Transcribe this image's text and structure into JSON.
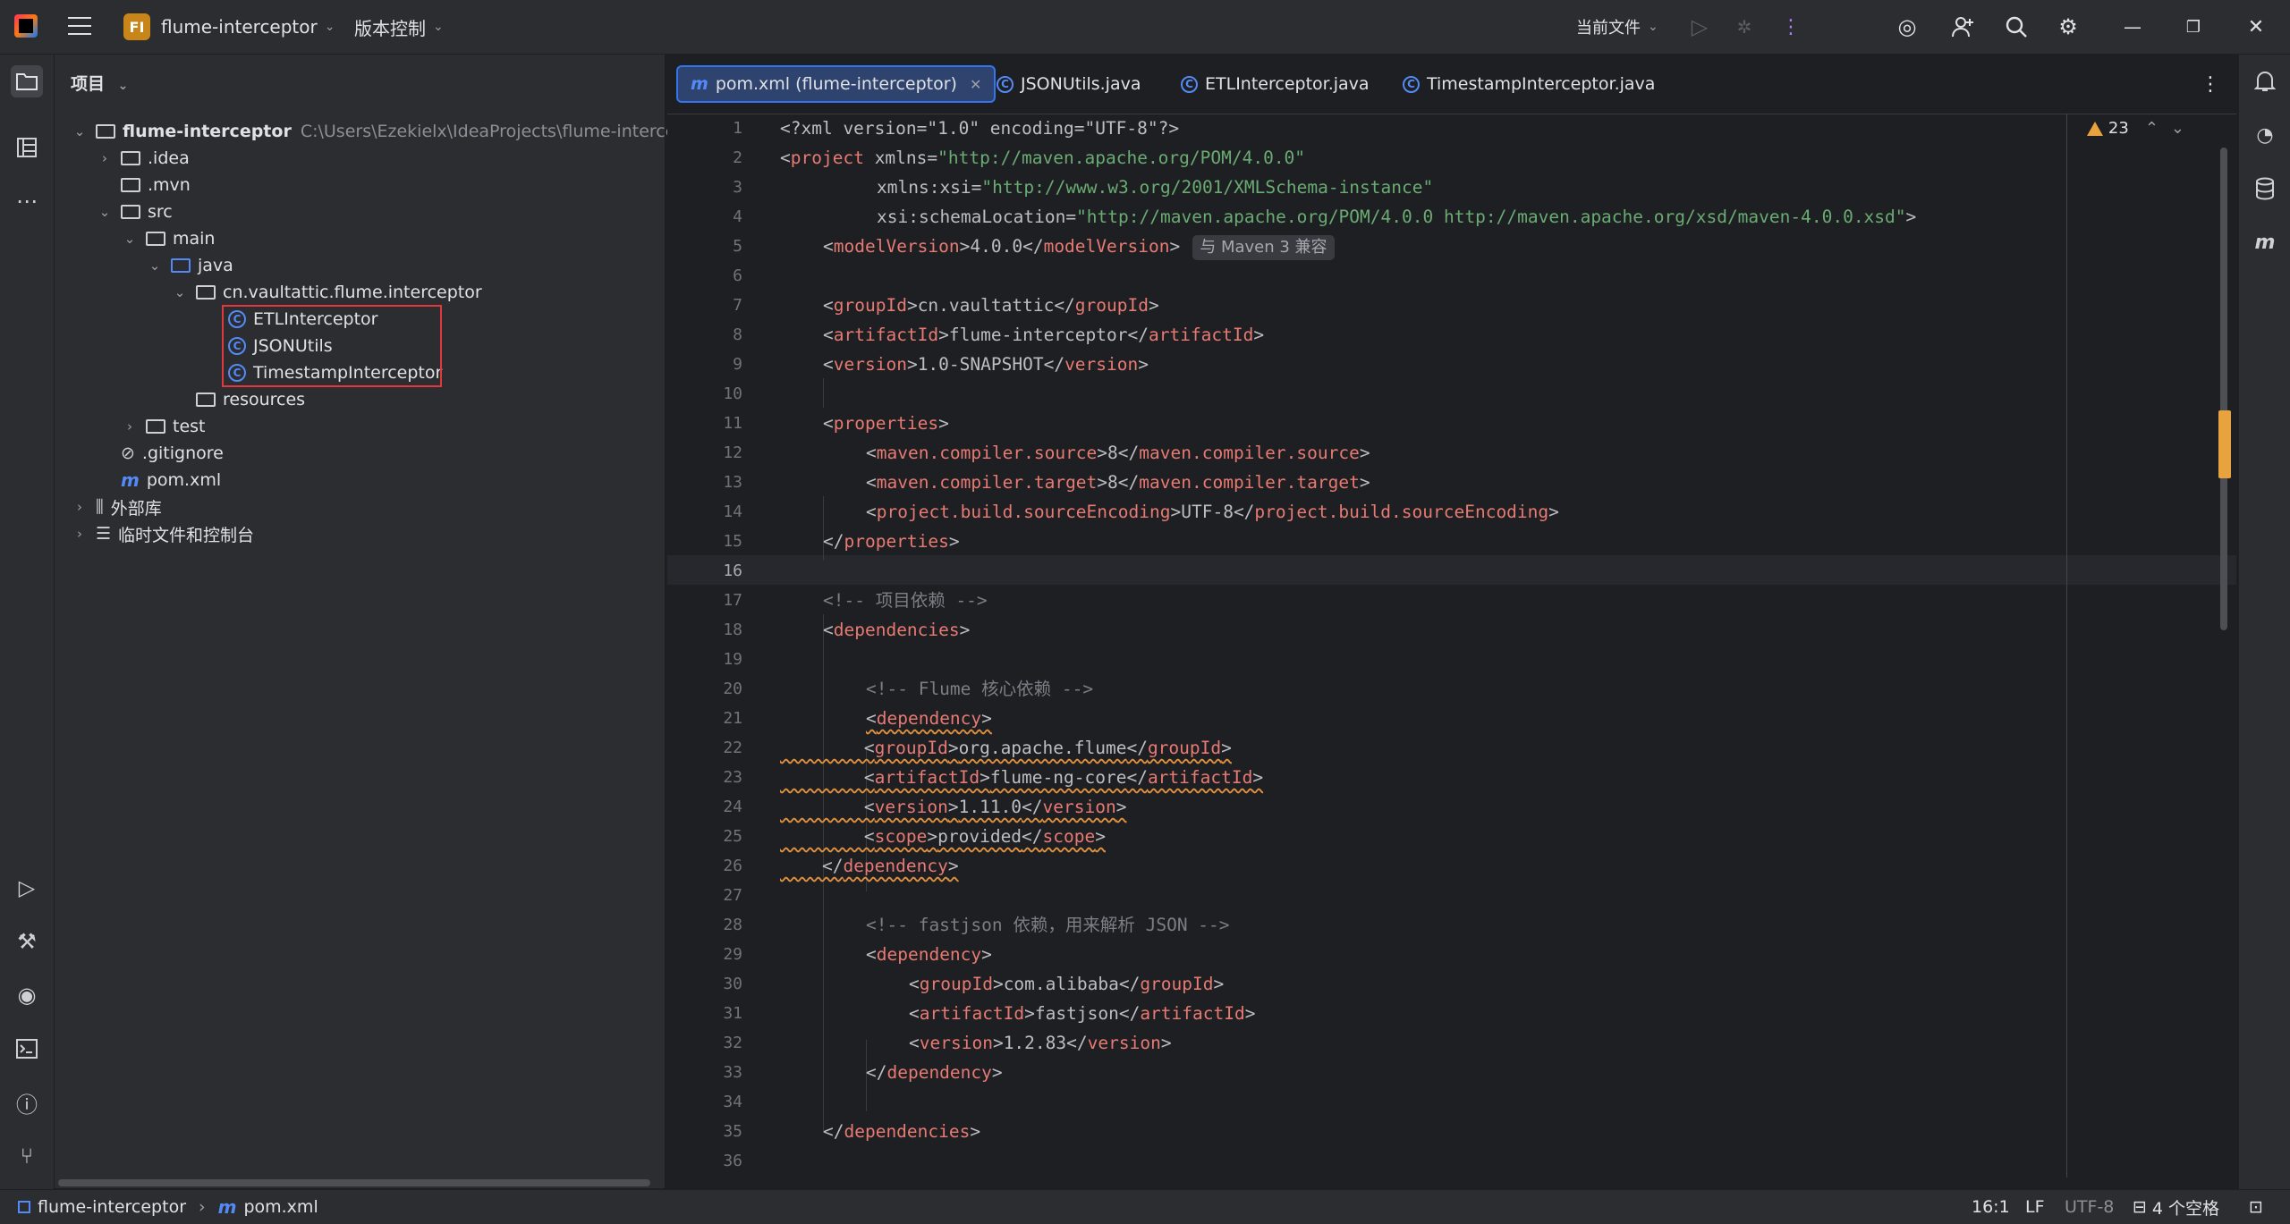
{
  "titlebar": {
    "project_badge": "FI",
    "project_name": "flume-interceptor",
    "vcs": "版本控制",
    "run_config": "当前文件"
  },
  "project_panel": {
    "title": "项目",
    "root_name": "flume-interceptor",
    "root_path": "C:\\Users\\Ezekielx\\IdeaProjects\\flume-interceptor",
    "idea": ".idea",
    "mvn": ".mvn",
    "src": "src",
    "main": "main",
    "java": "java",
    "package": "cn.vaultattic.flume.interceptor",
    "classes": [
      "ETLInterceptor",
      "JSONUtils",
      "TimestampInterceptor"
    ],
    "resources": "resources",
    "test": "test",
    "gitignore": ".gitignore",
    "pom": "pom.xml",
    "external_libs": "外部库",
    "scratches": "临时文件和控制台"
  },
  "tabs": [
    {
      "label": "pom.xml (flume-interceptor)",
      "icon": "maven-icon",
      "active": true
    },
    {
      "label": "JSONUtils.java",
      "icon": "class-icon"
    },
    {
      "label": "ETLInterceptor.java",
      "icon": "class-icon"
    },
    {
      "label": "TimestampInterceptor.java",
      "icon": "class-icon"
    }
  ],
  "editor": {
    "warnings_count": "23",
    "maven_hint": "与 Maven 3 兼容",
    "line_numbers": [
      "1",
      "2",
      "3",
      "4",
      "5",
      "6",
      "7",
      "8",
      "9",
      "10",
      "11",
      "12",
      "13",
      "14",
      "15",
      "16",
      "17",
      "18",
      "19",
      "20",
      "21",
      "22",
      "23",
      "24",
      "25",
      "26",
      "27",
      "28",
      "29",
      "30",
      "31",
      "32",
      "33",
      "34",
      "35",
      "36"
    ],
    "code": {
      "l1": "<?xml version=\"1.0\" encoding=\"UTF-8\"?>",
      "l2_tag": "project",
      "l2_attr": "xmlns=",
      "l2_val": "\"http://maven.apache.org/POM/4.0.0\"",
      "l3_attr": "xmlns:xsi=",
      "l3_val": "\"http://www.w3.org/2001/XMLSchema-instance\"",
      "l4_attr": "xsi:schemaLocation=",
      "l4_val": "\"http://maven.apache.org/POM/4.0.0 http://maven.apache.org/xsd/maven-4.0.0.xsd\"",
      "modelVersion_tag": "modelVersion",
      "modelVersion_val": "4.0.0",
      "groupId_tag": "groupId",
      "groupId_val": "cn.vaultattic",
      "artifactId_tag": "artifactId",
      "artifactId_val": "flume-interceptor",
      "version_tag": "version",
      "version_val": "1.0-SNAPSHOT",
      "properties_tag": "properties",
      "mcs_tag": "maven.compiler.source",
      "mcs_val": "8",
      "mct_tag": "maven.compiler.target",
      "mct_val": "8",
      "pbse_tag": "project.build.sourceEncoding",
      "pbse_val": "UTF-8",
      "c17": "<!-- 项目依赖 -->",
      "dependencies_tag": "dependencies",
      "c20": "<!-- Flume 核心依赖 -->",
      "dependency_tag": "dependency",
      "d1_groupId": "org.apache.flume",
      "d1_artifactId": "flume-ng-core",
      "d1_version": "1.11.0",
      "scope_tag": "scope",
      "d1_scope": "provided",
      "c28": "<!-- fastjson 依赖，用来解析 JSON -->",
      "d2_groupId": "com.alibaba",
      "d2_artifactId": "fastjson",
      "d2_version": "1.2.83"
    }
  },
  "statusbar": {
    "crumb_project": "flume-interceptor",
    "crumb_file": "pom.xml",
    "position": "16:1",
    "line_sep": "LF",
    "encoding": "UTF-8",
    "indent": "4 个空格"
  }
}
